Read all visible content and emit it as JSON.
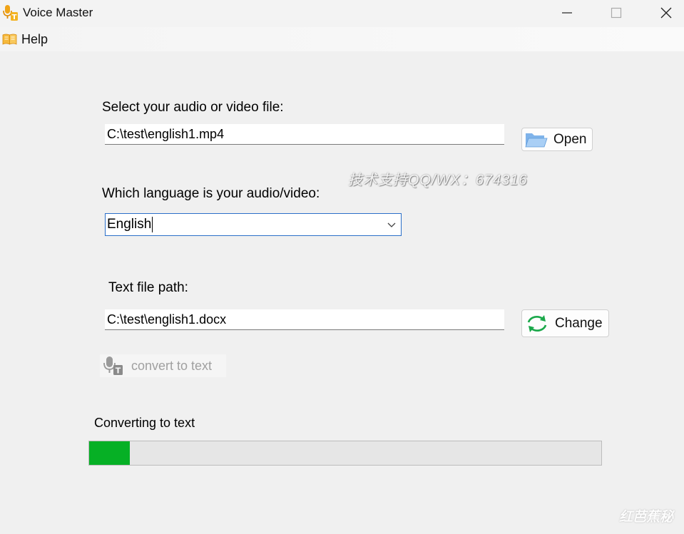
{
  "window": {
    "title": "Voice Master",
    "minimize_icon": "minimize-icon",
    "maximize_icon": "maximize-icon",
    "close_icon": "close-icon"
  },
  "menu": {
    "items": [
      {
        "label": "Help",
        "icon": "book-icon"
      }
    ]
  },
  "form": {
    "file_label": "Select your audio or video file:",
    "file_value": "C:\\test\\english1.mp4",
    "open_button": "Open",
    "language_label": "Which language is your audio/video:",
    "language_selected": "English",
    "output_label": "Text file path:",
    "output_value": "C:\\test\\english1.docx",
    "change_button": "Change",
    "convert_button": "convert to text"
  },
  "progress": {
    "status": "Converting to text",
    "percent": 8,
    "color": "#06b025"
  },
  "watermarks": {
    "center": "技术支持QQ/WX：674316",
    "corner": "红芭蕉秘"
  },
  "colors": {
    "accent": "#2b6fc9",
    "progress": "#06b025",
    "refresh": "#1aa84a"
  }
}
